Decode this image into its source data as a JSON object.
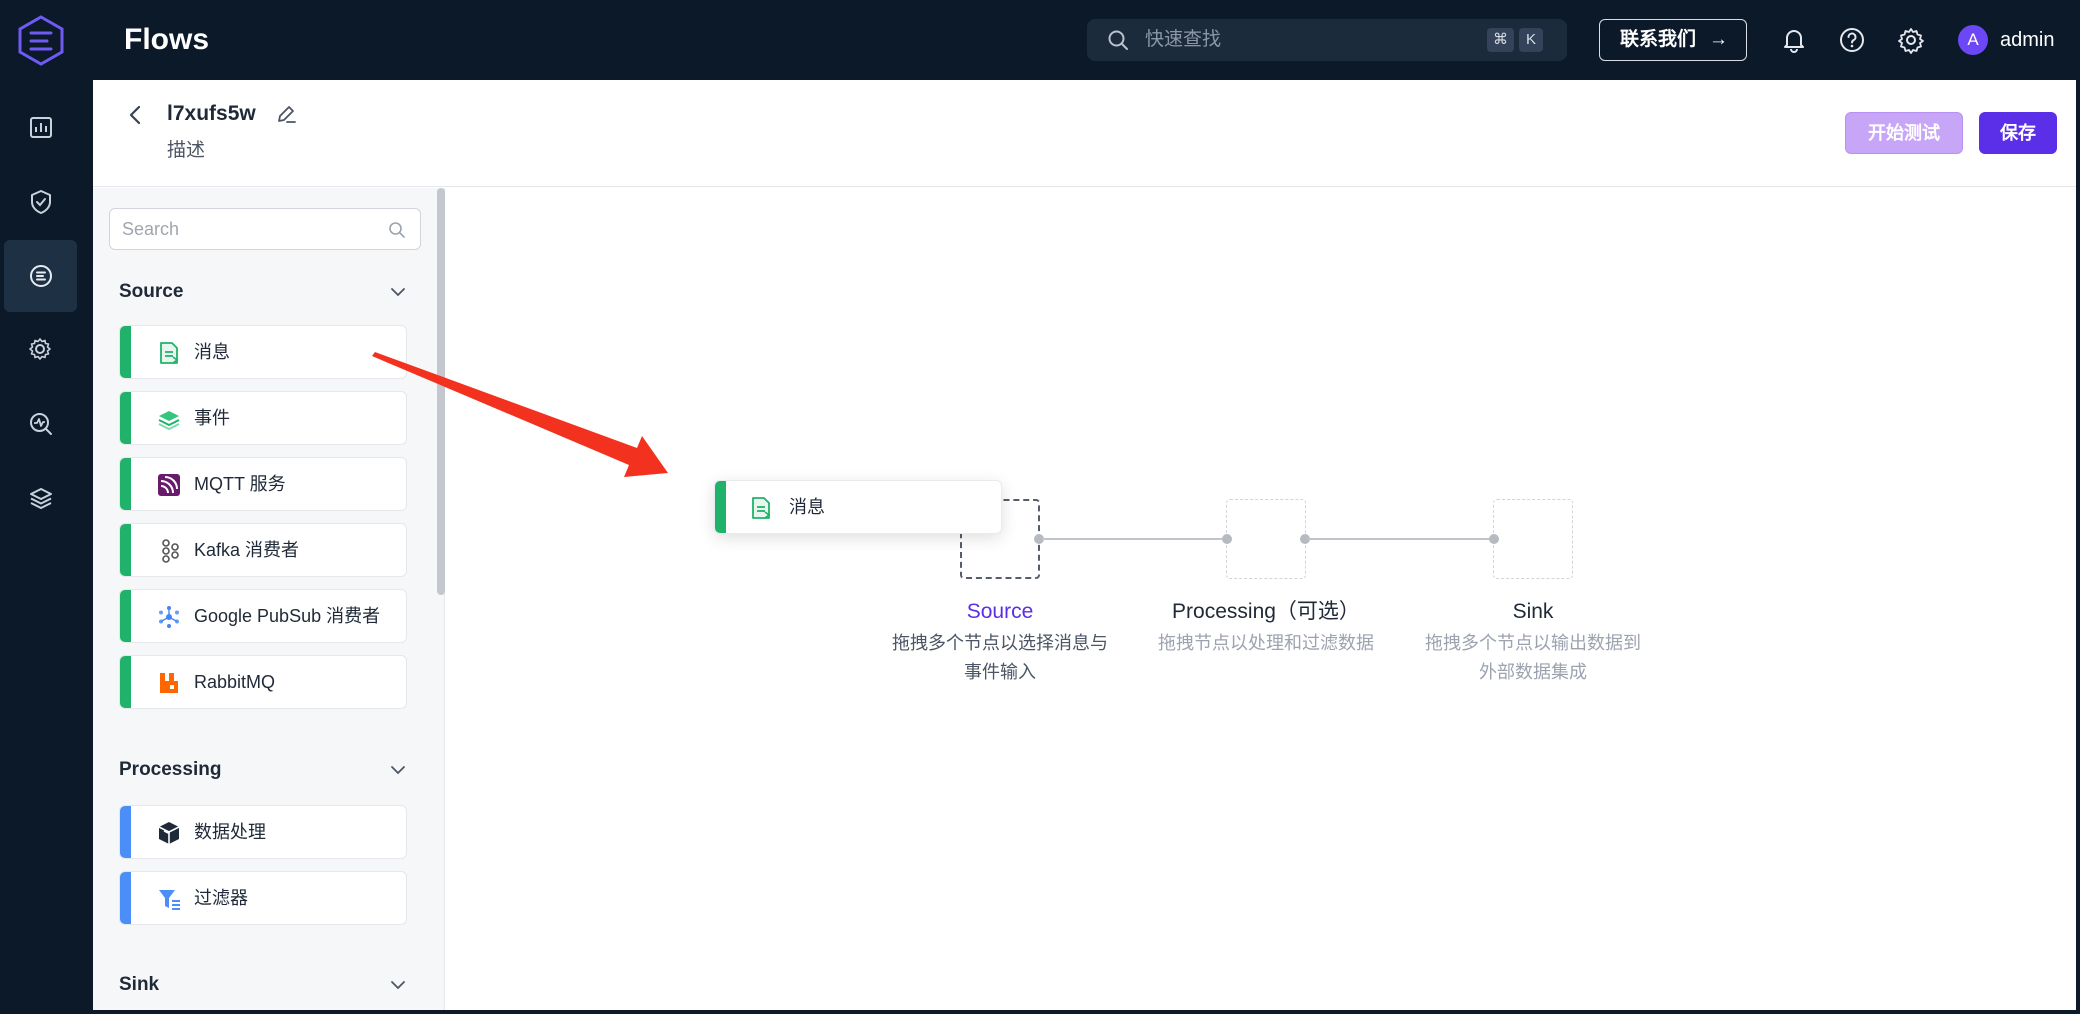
{
  "topbar": {
    "app_title": "Flows",
    "search_placeholder": "快速查找",
    "shortcut_cmd": "⌘",
    "shortcut_key": "K",
    "contact_label": "联系我们",
    "contact_arrow": "→",
    "user_initial": "A",
    "user_name": "admin"
  },
  "rail": {
    "items": [
      {
        "icon": "dashboard-icon"
      },
      {
        "icon": "shield-check-icon"
      },
      {
        "icon": "flows-icon",
        "active": true
      },
      {
        "icon": "gear-cloud-icon"
      },
      {
        "icon": "monitor-search-icon"
      },
      {
        "icon": "layers-icon"
      }
    ]
  },
  "header": {
    "flow_name": "l7xufs5w",
    "description": "描述",
    "test_button": "开始测试",
    "save_button": "保存"
  },
  "sidebar": {
    "search_placeholder": "Search",
    "source": {
      "title": "Source",
      "accent": "#20b26b",
      "items": [
        {
          "label": "消息",
          "icon": "message-doc-icon"
        },
        {
          "label": "事件",
          "icon": "event-layers-icon"
        },
        {
          "label": "MQTT 服务",
          "icon": "mqtt-icon"
        },
        {
          "label": "Kafka 消费者",
          "icon": "kafka-icon"
        },
        {
          "label": "Google PubSub 消费者",
          "icon": "pubsub-icon"
        },
        {
          "label": "RabbitMQ",
          "icon": "rabbitmq-icon"
        }
      ]
    },
    "processing": {
      "title": "Processing",
      "accent": "#4c8ef7",
      "items": [
        {
          "label": "数据处理",
          "icon": "data-processing-icon"
        },
        {
          "label": "过滤器",
          "icon": "filter-icon"
        }
      ]
    },
    "sink": {
      "title": "Sink"
    }
  },
  "canvas": {
    "dragging_node": "消息",
    "steps": [
      {
        "title": "Source",
        "desc_line1": "拖拽多个节点以选择消息与",
        "desc_line2": "事件输入"
      },
      {
        "title": "Processing（可选）",
        "desc_line1": "拖拽节点以处理和过滤数据",
        "desc_line2": ""
      },
      {
        "title": "Sink",
        "desc_line1": "拖拽多个节点以输出数据到",
        "desc_line2": "外部数据集成"
      }
    ]
  },
  "colors": {
    "topbar_bg": "#0b1929",
    "primary": "#5b2ee8",
    "source_accent": "#20b26b",
    "processing_accent": "#4c8ef7",
    "annotation_arrow": "#f2321e"
  }
}
